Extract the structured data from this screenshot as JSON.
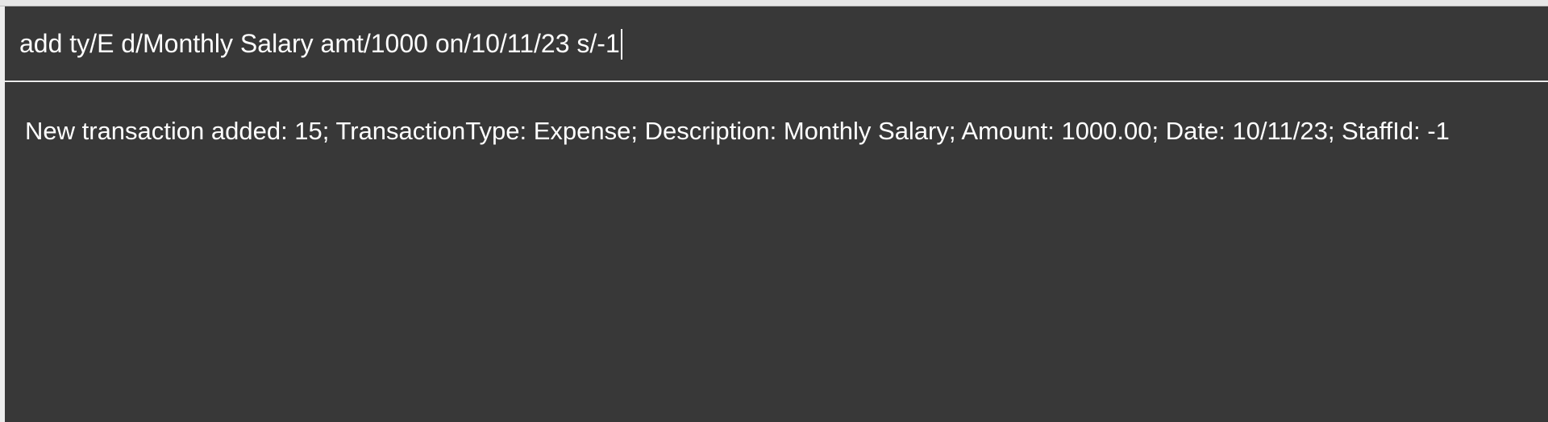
{
  "command_box": {
    "value": "add ty/E d/Monthly Salary amt/1000 on/10/11/23 s/-1"
  },
  "result_display": {
    "text": "New transaction added: 15; TransactionType: Expense; Description: Monthly Salary; Amount: 1000.00; Date: 10/11/23; StaffId: -1"
  },
  "colors": {
    "background": "#383838",
    "text": "#ffffff",
    "divider": "#eaeaea"
  }
}
